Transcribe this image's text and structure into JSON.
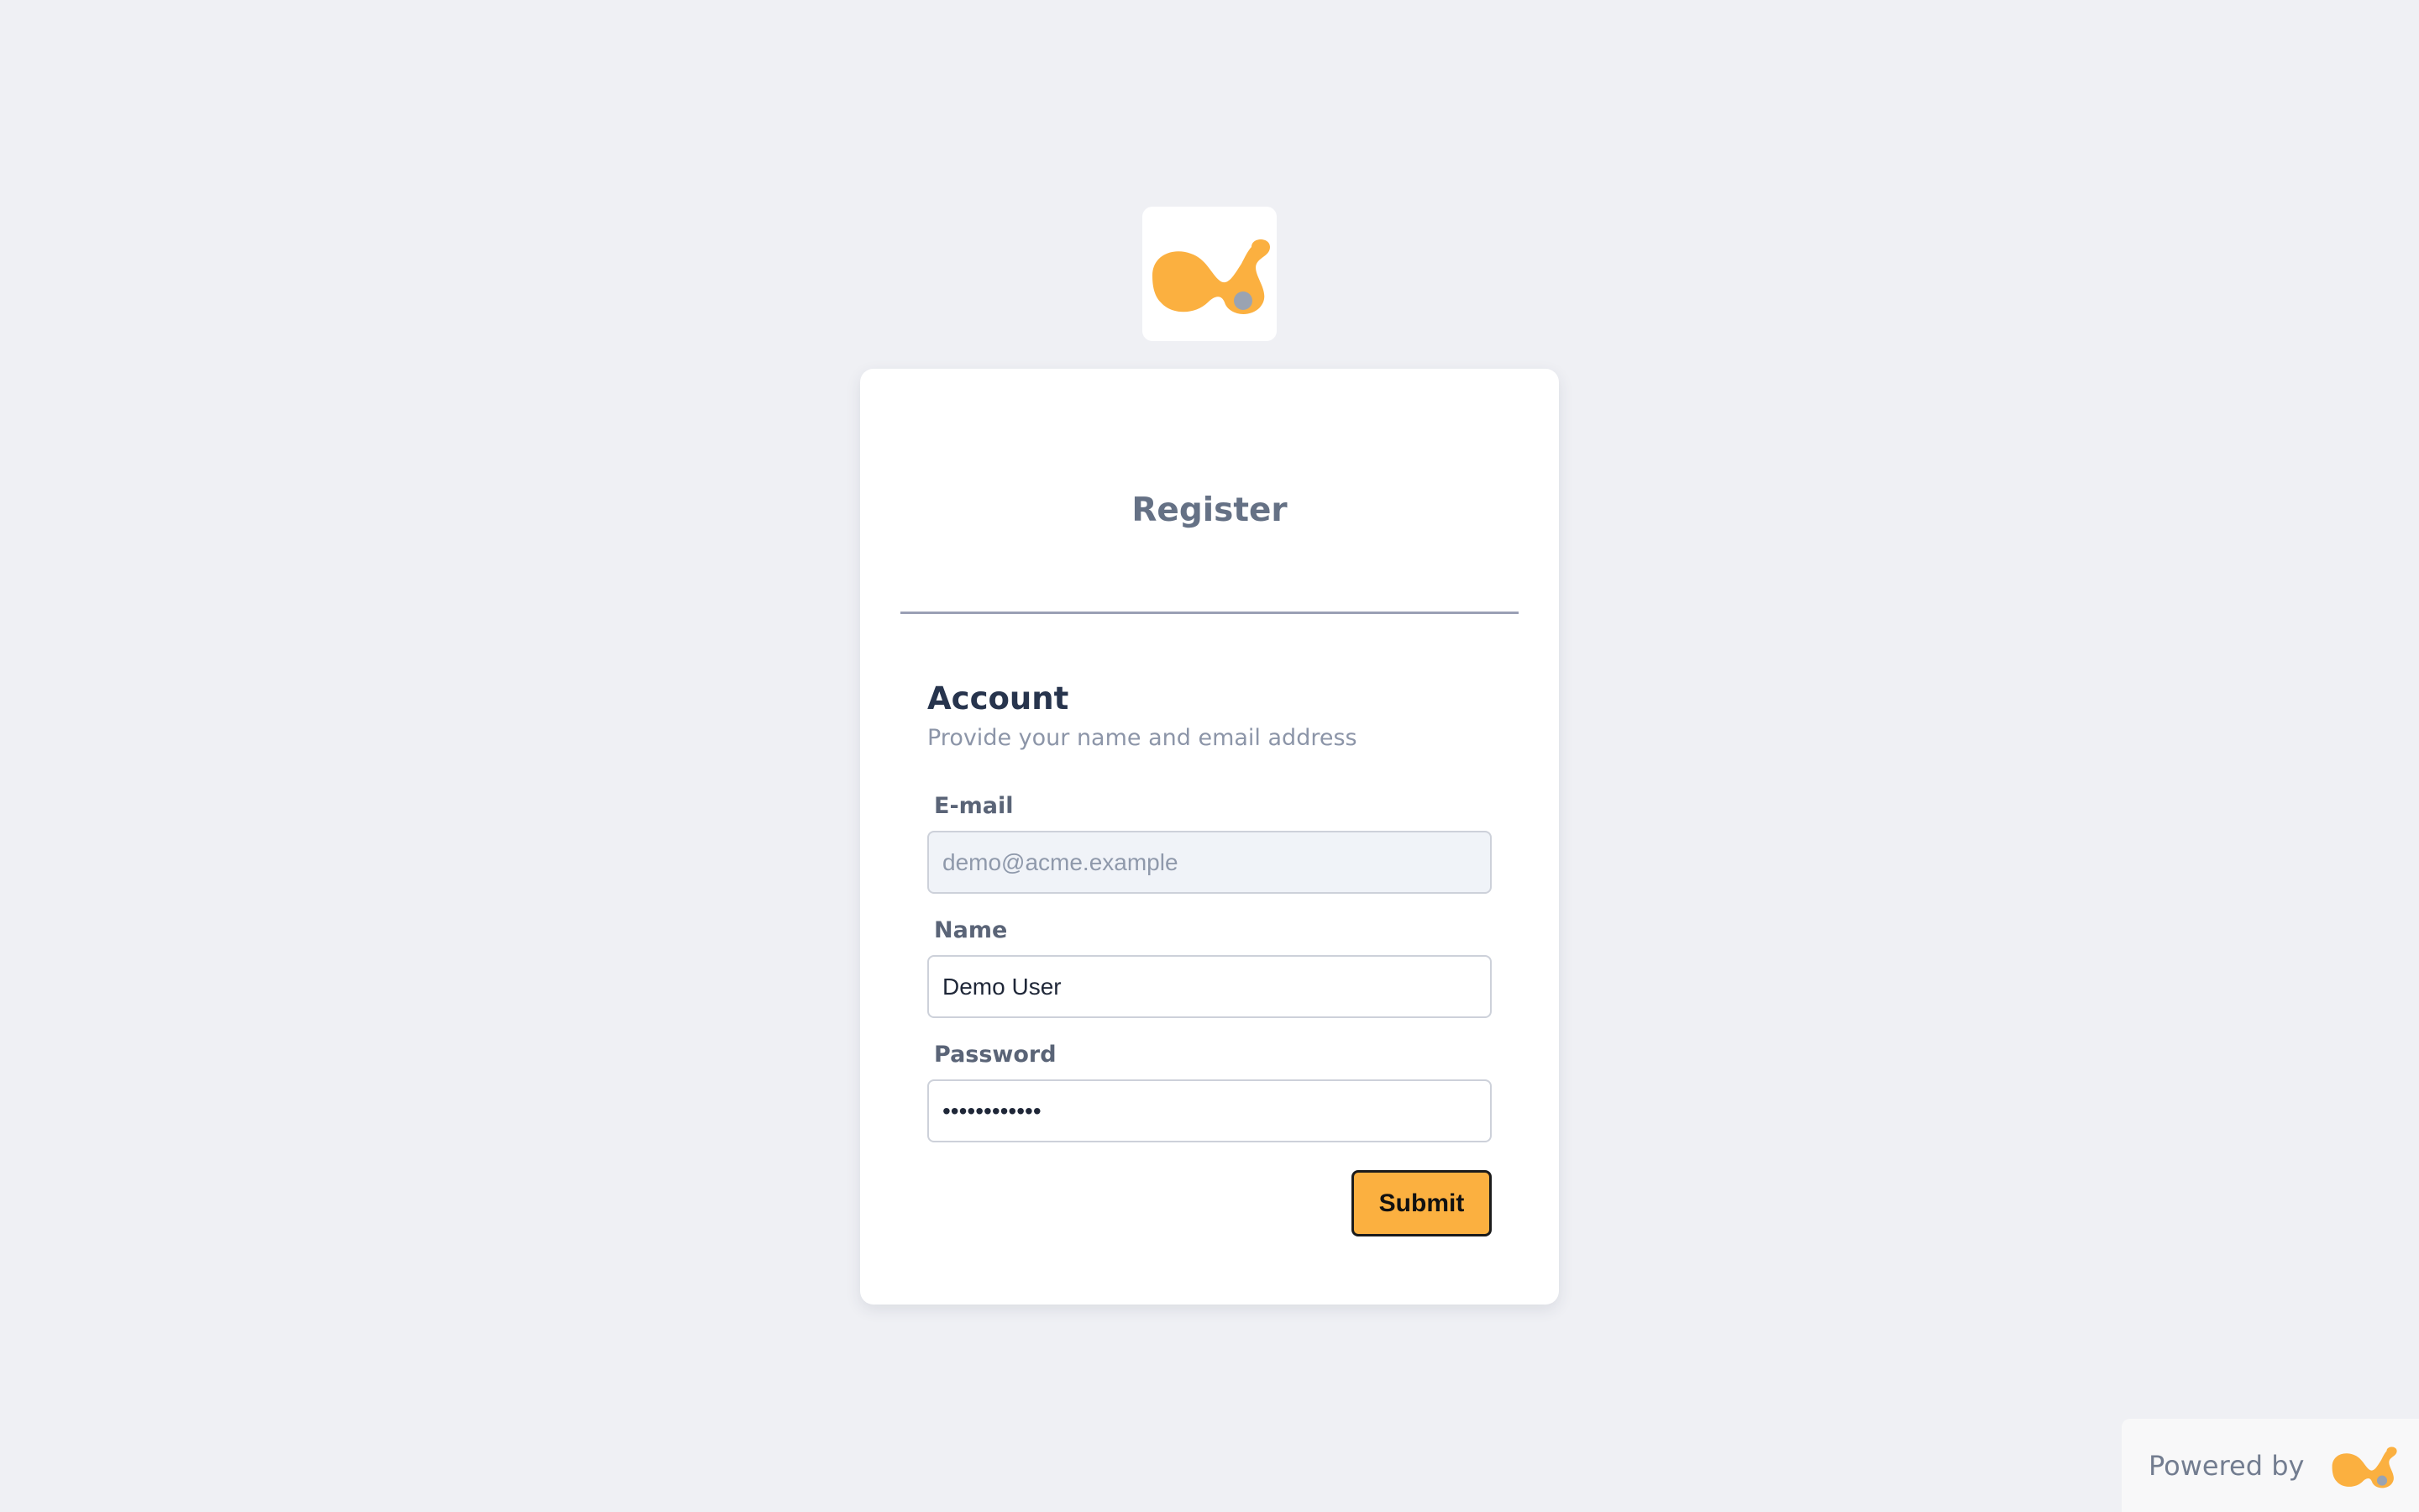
{
  "colors": {
    "background": "#eff0f4",
    "accent": "#fbb040",
    "logo_dot": "#9aa3b2"
  },
  "logo": {
    "icon": "brand-logo-icon"
  },
  "card": {
    "title": "Register"
  },
  "section": {
    "title": "Account",
    "subtitle": "Provide your name and email address"
  },
  "fields": {
    "email": {
      "label": "E-mail",
      "value": "demo@acme.example",
      "disabled": true
    },
    "name": {
      "label": "Name",
      "value": "Demo User"
    },
    "password": {
      "label": "Password",
      "value": "demopassword"
    }
  },
  "actions": {
    "submit_label": "Submit"
  },
  "footer": {
    "powered_by": "Powered by"
  }
}
